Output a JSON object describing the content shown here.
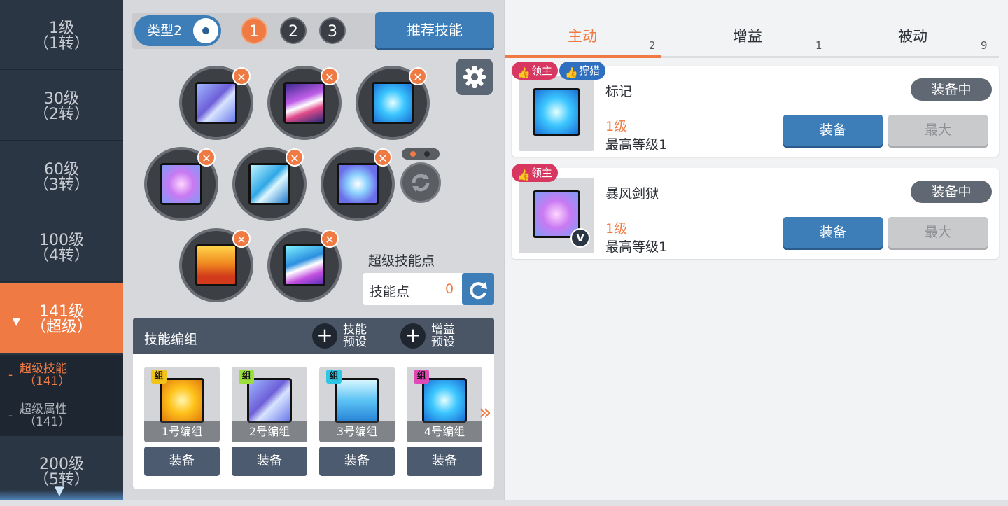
{
  "left_nav": {
    "tiers": [
      {
        "l1": "1级",
        "l2": "（1转）"
      },
      {
        "l1": "30级",
        "l2": "（2转）"
      },
      {
        "l1": "60级",
        "l2": "（3转）"
      },
      {
        "l1": "100级",
        "l2": "（4转）"
      },
      {
        "l1": "141级",
        "l2": "（超级）",
        "active": true
      },
      {
        "l1": "200级",
        "l2": "（5转）"
      }
    ],
    "sub_items": [
      {
        "label": "超级技能",
        "num": "（141）",
        "active": true
      },
      {
        "label": "超级属性",
        "num": "（141）"
      }
    ],
    "dash": "-"
  },
  "top_bar": {
    "type_label": "类型2",
    "numbers": [
      "1",
      "2",
      "3"
    ],
    "recommend_label": "推荐技能"
  },
  "slots": {
    "remove_glyph": "✕"
  },
  "super_skill_points": {
    "title": "超级技能点",
    "label": "技能点",
    "value": "0"
  },
  "combo": {
    "title": "技能编组",
    "plus_glyph": "+",
    "skill_preset": "技能预设",
    "buff_preset": "增益预设",
    "tag": "组",
    "cards": [
      {
        "caption": "1号编组",
        "equip": "装备"
      },
      {
        "caption": "2号编组",
        "equip": "装备"
      },
      {
        "caption": "3号编组",
        "equip": "装备"
      },
      {
        "caption": "4号编组",
        "equip": "装备"
      }
    ],
    "next_glyph": "»"
  },
  "tabs": [
    {
      "label": "主动",
      "count": "2",
      "active": true
    },
    {
      "label": "增益",
      "count": "1"
    },
    {
      "label": "被动",
      "count": "9"
    }
  ],
  "skills": [
    {
      "name": "标记",
      "level": "1级",
      "max_level": "最高等级1",
      "equipped": "装备中",
      "equip_btn": "装备",
      "max_btn": "最大",
      "badges": [
        "领主",
        "狩猎"
      ]
    },
    {
      "name": "暴风剑狱",
      "level": "1级",
      "max_level": "最高等级1",
      "equipped": "装备中",
      "equip_btn": "装备",
      "max_btn": "最大",
      "badges": [
        "领主"
      ],
      "v_mark": "V"
    }
  ],
  "colors": {
    "accent_orange": "#ef7a43",
    "primary_blue": "#3d7db8",
    "nav_dark": "#2b3645",
    "badge_lord": "#d83762",
    "badge_hunt": "#2f6fc0"
  },
  "icons": {
    "gear": "gear-icon",
    "refresh": "refresh-icon",
    "thumb": "thumb-up-icon",
    "remove": "remove-icon"
  }
}
